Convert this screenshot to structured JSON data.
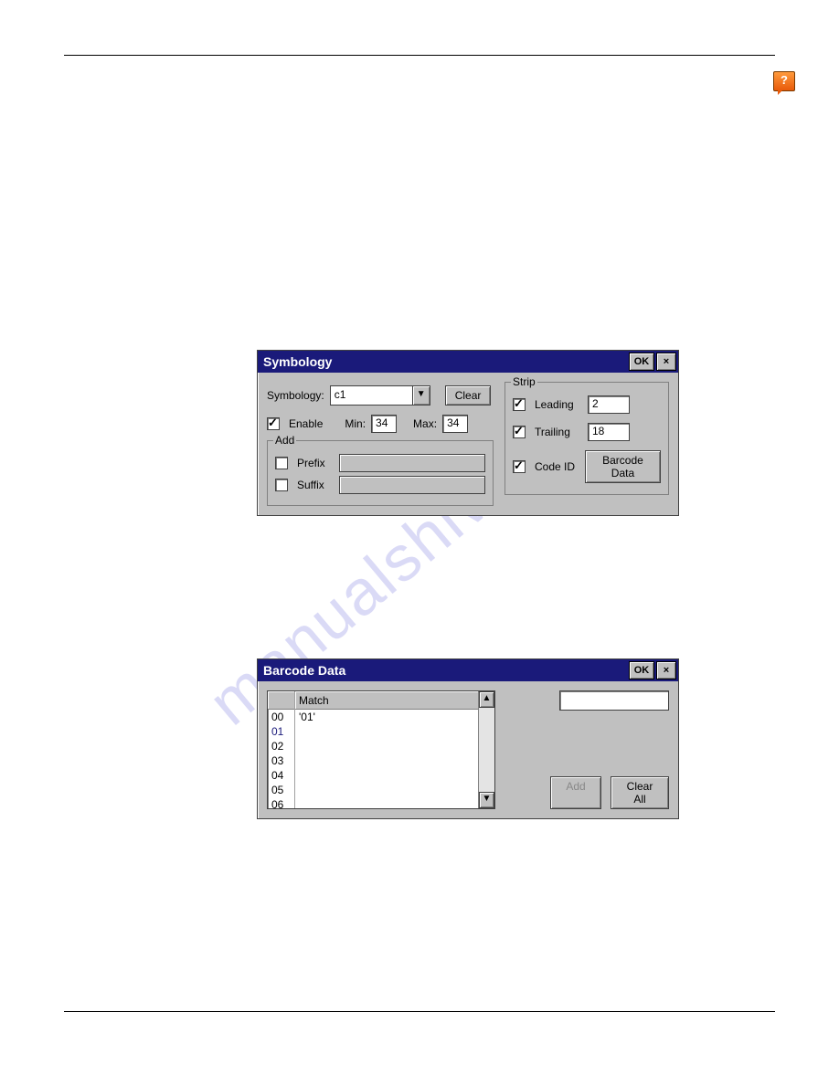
{
  "watermark": "manualshive.com",
  "symbology_window": {
    "title": "Symbology",
    "ok_label": "OK",
    "close_label": "×",
    "symbology_label": "Symbology:",
    "symbology_value": "c1",
    "clear_label": "Clear",
    "enable_label": "Enable",
    "enable_checked": true,
    "min_label": "Min:",
    "min_value": "34",
    "max_label": "Max:",
    "max_value": "34",
    "add_group_title": "Add",
    "prefix_label": "Prefix",
    "prefix_checked": false,
    "prefix_value": "",
    "suffix_label": "Suffix",
    "suffix_checked": false,
    "suffix_value": "",
    "strip_group_title": "Strip",
    "leading_label": "Leading",
    "leading_checked": true,
    "leading_value": "2",
    "trailing_label": "Trailing",
    "trailing_checked": true,
    "trailing_value": "18",
    "codeid_label": "Code ID",
    "codeid_checked": true,
    "barcode_data_btn": "Barcode Data"
  },
  "barcode_window": {
    "title": "Barcode Data",
    "ok_label": "OK",
    "close_label": "×",
    "match_header": "Match",
    "rows": [
      {
        "idx": "00",
        "match": "'01'"
      },
      {
        "idx": "01",
        "match": ""
      },
      {
        "idx": "02",
        "match": ""
      },
      {
        "idx": "03",
        "match": ""
      },
      {
        "idx": "04",
        "match": ""
      },
      {
        "idx": "05",
        "match": ""
      },
      {
        "idx": "06",
        "match": ""
      }
    ],
    "selected_index": 1,
    "input_value": "",
    "add_label": "Add",
    "clear_all_label": "Clear All",
    "scroll_up": "▲",
    "scroll_down": "▼"
  }
}
